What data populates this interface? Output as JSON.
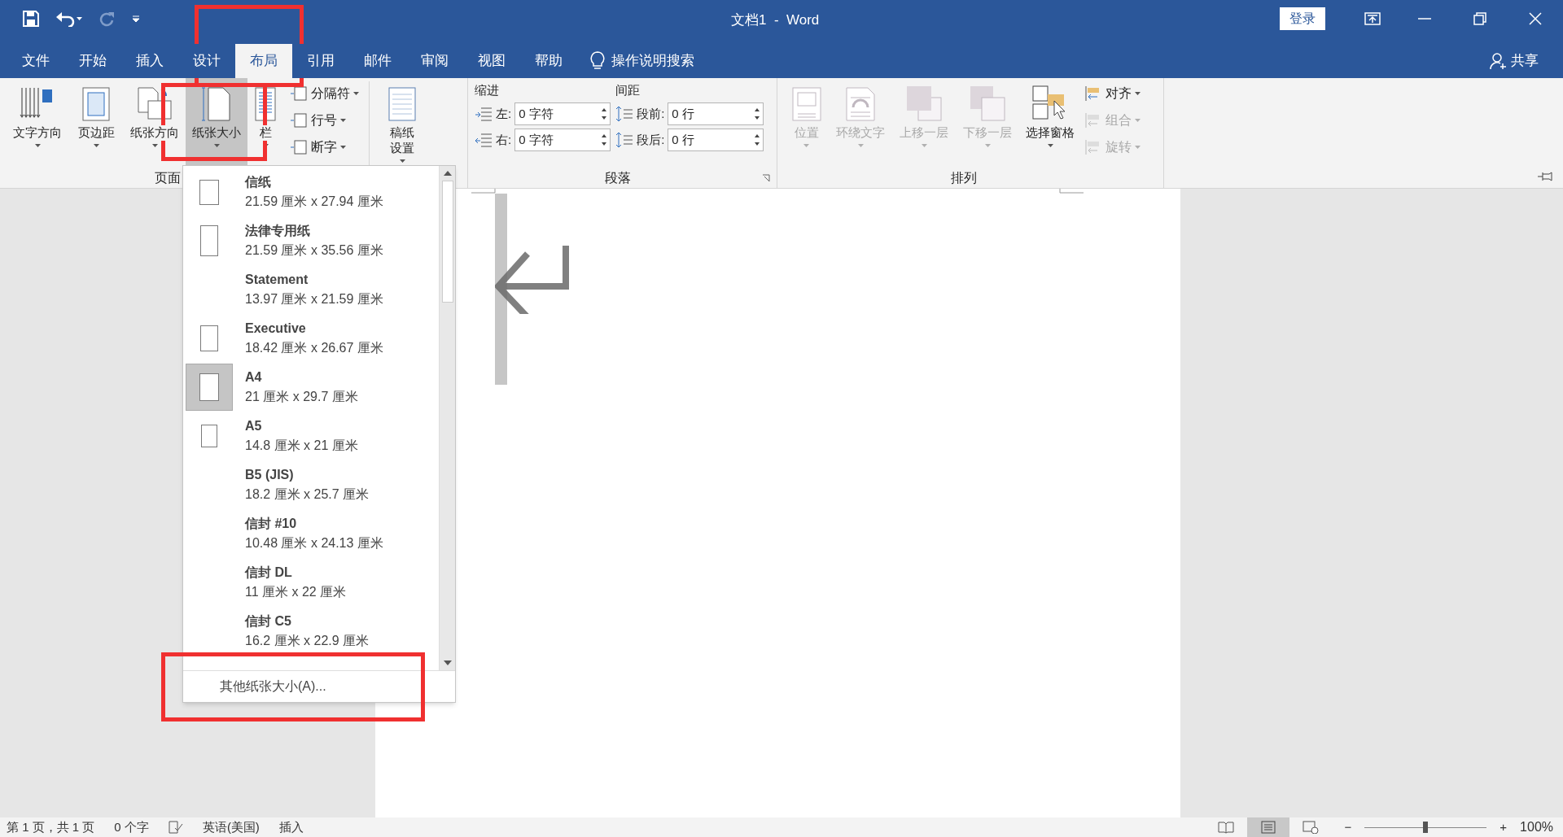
{
  "window": {
    "title": "文档1  -  Word",
    "login": "登录"
  },
  "tabs": [
    {
      "label": "文件",
      "selected": false
    },
    {
      "label": "开始",
      "selected": false
    },
    {
      "label": "插入",
      "selected": false
    },
    {
      "label": "设计",
      "selected": false
    },
    {
      "label": "布局",
      "selected": true
    },
    {
      "label": "引用",
      "selected": false
    },
    {
      "label": "邮件",
      "selected": false
    },
    {
      "label": "审阅",
      "selected": false
    },
    {
      "label": "视图",
      "selected": false
    },
    {
      "label": "帮助",
      "selected": false
    }
  ],
  "search": {
    "label": "操作说明搜索"
  },
  "share": "共享",
  "ribbon": {
    "page_setup": {
      "label": "页面",
      "large_buttons": [
        {
          "label": "文字方向",
          "selected": false
        },
        {
          "label": "页边距",
          "selected": false
        },
        {
          "label": "纸张方向",
          "selected": false
        },
        {
          "label": "纸张大小",
          "selected": true
        },
        {
          "label": "栏",
          "selected": false
        }
      ],
      "small_buttons": [
        "分隔符",
        "行号",
        "断字"
      ]
    },
    "manuscript": {
      "label": "稿纸设置"
    },
    "paragraph": {
      "label": "段落",
      "indent": {
        "heading": "缩进",
        "fields": [
          {
            "label": "左:",
            "value": "0 字符"
          },
          {
            "label": "右:",
            "value": "0 字符"
          }
        ]
      },
      "spacing": {
        "heading": "间距",
        "fields": [
          {
            "label": "段前:",
            "value": "0 行"
          },
          {
            "label": "段后:",
            "value": "0 行"
          }
        ]
      }
    },
    "arrange": {
      "label": "排列",
      "large_buttons": [
        {
          "label": "位置",
          "disabled": true
        },
        {
          "label": "环绕文字",
          "disabled": true
        },
        {
          "label": "上移一层",
          "disabled": true
        },
        {
          "label": "下移一层",
          "disabled": true
        },
        {
          "label": "选择窗格",
          "disabled": false
        }
      ],
      "small_buttons": [
        {
          "label": "对齐",
          "disabled": false
        },
        {
          "label": "组合",
          "disabled": true
        },
        {
          "label": "旋转",
          "disabled": true
        }
      ]
    }
  },
  "paper_menu": {
    "items": [
      {
        "name": "信纸",
        "size": "21.59 厘米 x 27.94 厘米",
        "kind": "letter",
        "selected": false
      },
      {
        "name": "法律专用纸",
        "size": "21.59 厘米 x 35.56 厘米",
        "kind": "legal",
        "selected": false
      },
      {
        "name": "Statement",
        "size": "13.97 厘米 x 21.59 厘米",
        "kind": "none",
        "selected": false
      },
      {
        "name": "Executive",
        "size": "18.42 厘米 x 26.67 厘米",
        "kind": "executive",
        "selected": false
      },
      {
        "name": "A4",
        "size": "21 厘米 x 29.7 厘米",
        "kind": "a4",
        "selected": true
      },
      {
        "name": "A5",
        "size": "14.8 厘米 x 21 厘米",
        "kind": "a5",
        "selected": false
      },
      {
        "name": "B5 (JIS)",
        "size": "18.2 厘米 x 25.7 厘米",
        "kind": "none",
        "selected": false
      },
      {
        "name": "信封 #10",
        "size": "10.48 厘米 x 24.13 厘米",
        "kind": "none",
        "selected": false
      },
      {
        "name": "信封 DL",
        "size": "11 厘米 x 22 厘米",
        "kind": "none",
        "selected": false
      },
      {
        "name": "信封 C5",
        "size": "16.2 厘米 x 22.9 厘米",
        "kind": "none",
        "selected": false
      }
    ],
    "footer": "其他纸张大小(A)..."
  },
  "status_bar": {
    "page": "第 1 页，共 1 页",
    "words": "0 个字",
    "language": "英语(美国)",
    "mode": "插入",
    "zoom": {
      "minus": "−",
      "plus": "+",
      "level": 0.5,
      "reading": "100%"
    }
  }
}
